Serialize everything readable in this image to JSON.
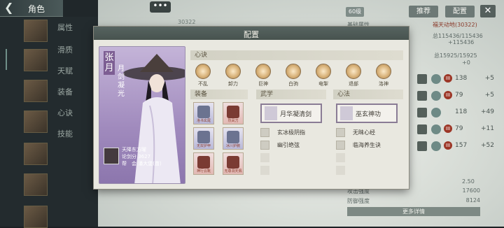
{
  "topbar": {
    "back_icon": "back-arrow-icon",
    "title": "角色"
  },
  "sidebar": {
    "tabs": [
      "属性",
      "滑质",
      "天赋",
      "装备",
      "心诀",
      "技能"
    ]
  },
  "scene": {
    "dots": "•••",
    "top_value": "30322"
  },
  "right_panel": {
    "badge": "60级",
    "buttons": [
      "推荐",
      "配置"
    ],
    "close": "✕",
    "basic_attr": "基础属性",
    "highlight": "福天动地(30322)",
    "texts": [
      "总115436/115436",
      "+115436",
      "总15925/15925",
      "+0"
    ],
    "rows": [
      {
        "value": "138",
        "delta": "+5"
      },
      {
        "value": "79",
        "delta": "+5"
      },
      {
        "value": "118",
        "delta": "+49"
      },
      {
        "value": "79",
        "delta": "+11"
      },
      {
        "value": "157",
        "delta": "+52"
      }
    ],
    "small_val": "2.50",
    "stats": [
      {
        "label": "攻击强度",
        "value": "17600"
      },
      {
        "label": "防御强度",
        "value": "8124"
      }
    ],
    "more_button": "更多详情"
  },
  "modal": {
    "title": "配置",
    "character": {
      "name": "张月",
      "title": "月剑凝光",
      "lines": [
        "天降东方曜",
        "论剑分 3627",
        "帮　会 潘大堡(苗)"
      ]
    },
    "xinjue": {
      "header": "心诀",
      "skills": [
        "不乱",
        "卸力",
        "巨神",
        "白驹",
        "电掣",
        "退部",
        "洛神"
      ]
    },
    "equipment": {
      "header": "装备",
      "items": [
        {
          "label": "洛书玄尾",
          "rarity": "blue"
        },
        {
          "label": "烈凤刀",
          "rarity": "red"
        },
        {
          "label": "无双护甲",
          "rarity": "blue"
        },
        {
          "label": "冰川护腕",
          "rarity": "blue"
        },
        {
          "label": "神行云靴",
          "rarity": "red"
        },
        {
          "label": "无尊洞天佩",
          "rarity": "red"
        }
      ]
    },
    "wuxue": {
      "header": "武学",
      "main": "月华凝清剑",
      "subs": [
        "玄冰极阴指",
        "幽引绝弦"
      ]
    },
    "xinfa": {
      "header": "心法",
      "main": "巫玄神功",
      "subs": [
        "无昧心经",
        "临海养生诀"
      ]
    }
  },
  "colors": {
    "header_bg": "#566360",
    "accent_purple": "#7d5e93",
    "rarity_red": "#8a3a2a"
  }
}
